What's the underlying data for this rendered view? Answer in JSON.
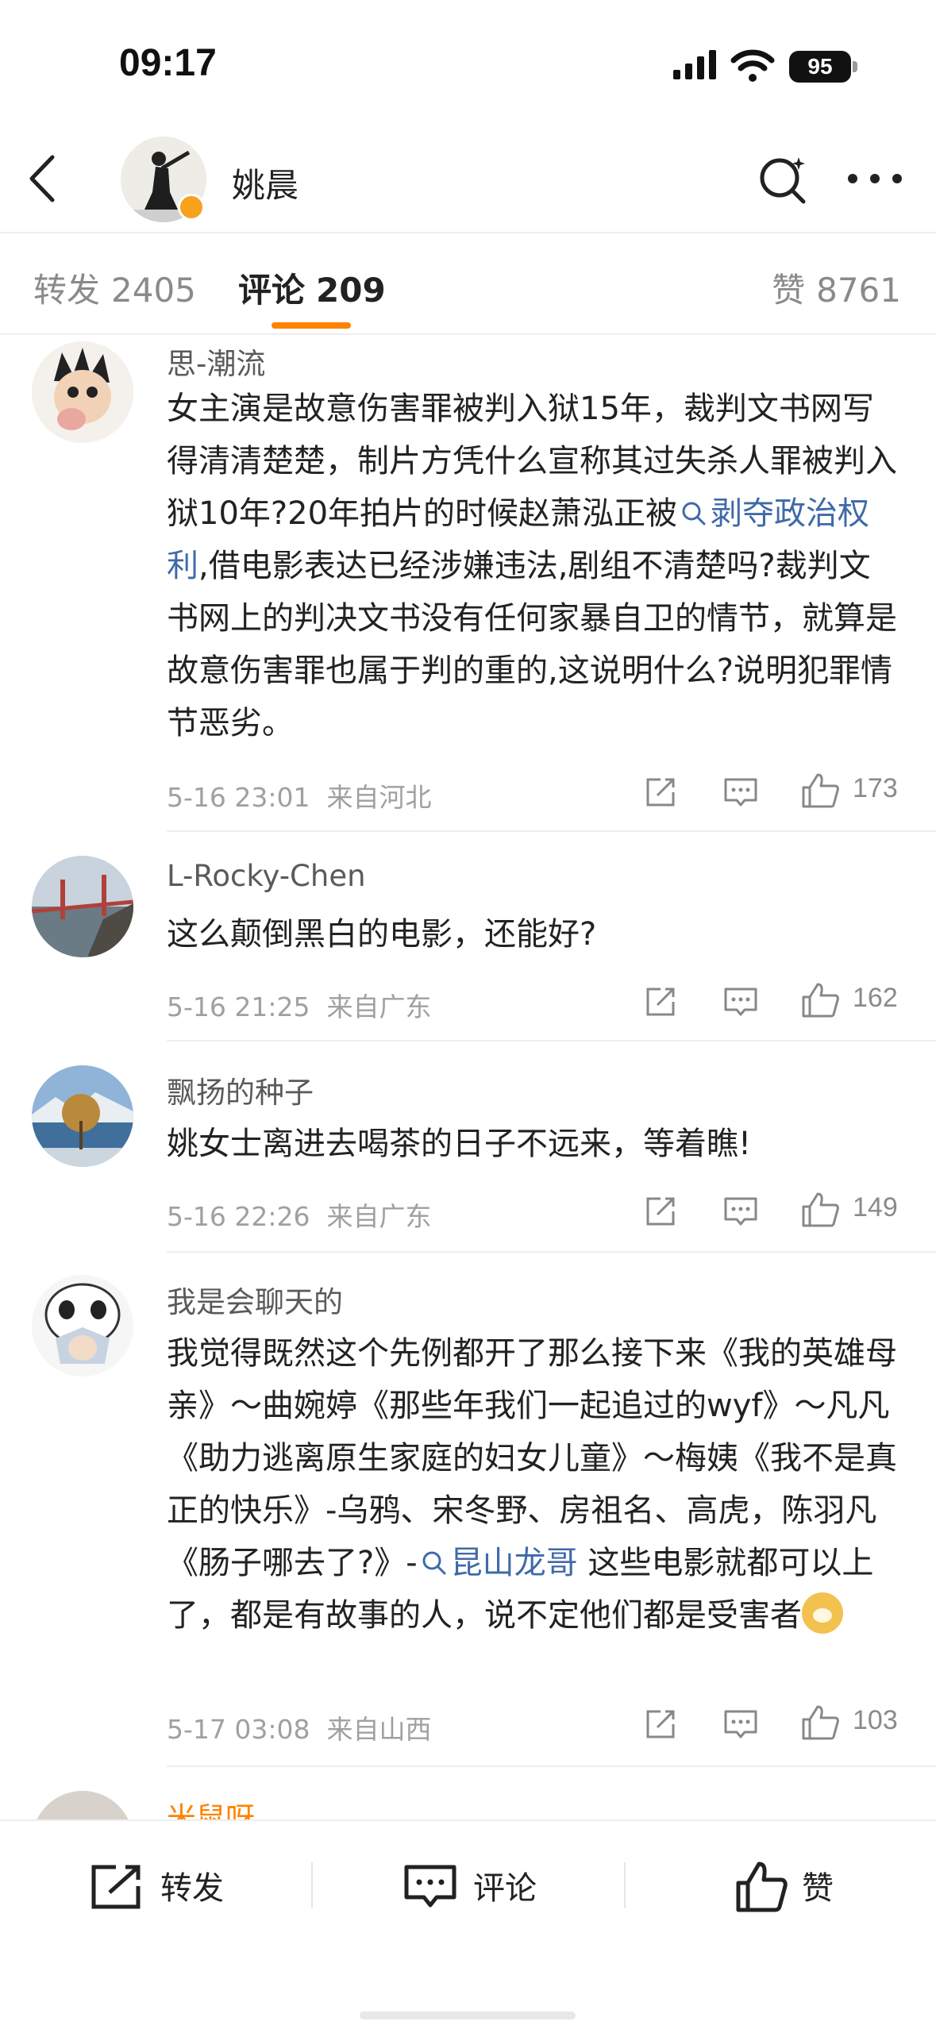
{
  "status_bar": {
    "time": "09:17",
    "battery": "95"
  },
  "header": {
    "title": "姚晨"
  },
  "tabs": {
    "repost": {
      "label": "转发",
      "count": "2405"
    },
    "comment": {
      "label": "评论",
      "count": "209"
    },
    "like": {
      "label": "赞",
      "count": "8761"
    }
  },
  "comments": [
    {
      "user": "思-潮流",
      "text_before_topic": "女主演是故意伤害罪被判入狱15年，裁判文书网写得清清楚楚，制片方凭什么宣称其过失杀人罪被判入狱10年?20年拍片的时候赵萧泓正被",
      "topic": "剥夺政治权利",
      "text_after_topic": ",借电影表达已经涉嫌违法,剧组不清楚吗?裁判文书网上的判决文书没有任何家暴自卫的情节，就算是故意伤害罪也属于判的重的,这说明什么?说明犯罪情节恶劣。",
      "date": "5-16 23:01",
      "location": "来自河北",
      "likes": "173"
    },
    {
      "user": "L-Rocky-Chen",
      "text": "这么颠倒黑白的电影，还能好?",
      "date": "5-16 21:25",
      "location": "来自广东",
      "likes": "162"
    },
    {
      "user": "飘扬的种子",
      "text": "姚女士离进去喝茶的日子不远来，等着瞧!",
      "date": "5-16 22:26",
      "location": "来自广东",
      "likes": "149"
    },
    {
      "user": "我是会聊天的",
      "text_before_topic": "我觉得既然这个先例都开了那么接下来《我的英雄母亲》～曲婉婷《那些年我们一起追过的wyf》～凡凡《助力逃离原生家庭的妇女儿童》～梅姨《我不是真正的快乐》-乌鸦、宋冬野、房祖名、高虎，陈羽凡《肠子哪去了?》-",
      "topic": "昆山龙哥",
      "text_after_topic": " 这些电影就都可以上了，都是有故事的人，说不定他们都是受害者",
      "emoji": "doge",
      "date": "5-17 03:08",
      "location": "来自山西",
      "likes": "103"
    },
    {
      "user": "米鼠呀"
    }
  ],
  "bottom_bar": {
    "repost": "转发",
    "comment": "评论",
    "like": "赞"
  },
  "colors": {
    "accent": "#ff8200",
    "topic": "#3f6aa8",
    "meta": "#a0a0a0"
  }
}
